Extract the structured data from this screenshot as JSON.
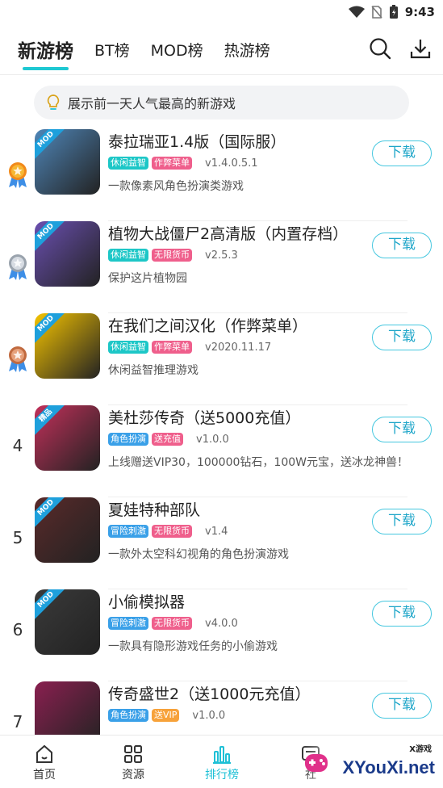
{
  "status": {
    "time": "9:43"
  },
  "tabs": [
    {
      "label": "新游榜",
      "active": true
    },
    {
      "label": "BT榜",
      "active": false
    },
    {
      "label": "MOD榜",
      "active": false
    },
    {
      "label": "热游榜",
      "active": false
    }
  ],
  "tip": {
    "text": "展示前一天人气最高的新游戏",
    "icon": "lightbulb-icon"
  },
  "download_label": "下载",
  "games": [
    {
      "rank": "1",
      "medal": "gold",
      "title": "泰拉瑞亚1.4版（国际服）",
      "badge": "MOD",
      "tags": [
        {
          "text": "休闲益智",
          "color": "#1dc7c7"
        },
        {
          "text": "作弊菜单",
          "color": "#ef5f8c"
        }
      ],
      "version": "v1.4.0.5.1",
      "desc": "一款像素风角色扮演类游戏",
      "thumb_color": "#4f86b8"
    },
    {
      "rank": "2",
      "medal": "silver",
      "title": "植物大战僵尸2高清版（内置存档）",
      "badge": "MOD",
      "tags": [
        {
          "text": "休闲益智",
          "color": "#1dc7c7"
        },
        {
          "text": "无限货币",
          "color": "#ef5f8c"
        }
      ],
      "version": "v2.5.3",
      "desc": "保护这片植物园",
      "thumb_color": "#6a4fb0"
    },
    {
      "rank": "3",
      "medal": "bronze",
      "title": "在我们之间汉化（作弊菜单）",
      "badge": "MOD",
      "tags": [
        {
          "text": "休闲益智",
          "color": "#1dc7c7"
        },
        {
          "text": "作弊菜单",
          "color": "#ef5f8c"
        }
      ],
      "version": "v2020.11.17",
      "desc": "休闲益智推理游戏",
      "thumb_color": "#f5c400"
    },
    {
      "rank": "4",
      "medal": "",
      "title": "美杜莎传奇（送5000充值）",
      "badge": "精品",
      "tags": [
        {
          "text": "角色扮演",
          "color": "#3aa0e8"
        },
        {
          "text": "送充值",
          "color": "#ef5f8c"
        }
      ],
      "version": "v1.0.0",
      "desc": "上线赠送VIP30，100000钻石，100W元宝，送冰龙神兽！",
      "thumb_color": "#c2305a"
    },
    {
      "rank": "5",
      "medal": "",
      "title": "夏娃特种部队",
      "badge": "MOD",
      "tags": [
        {
          "text": "冒险刺激",
          "color": "#3aa0e8"
        },
        {
          "text": "无限货币",
          "color": "#ef5f8c"
        }
      ],
      "version": "v1.4",
      "desc": "一款外太空科幻视角的角色扮演游戏",
      "thumb_color": "#5a2a2a"
    },
    {
      "rank": "6",
      "medal": "",
      "title": "小偷模拟器",
      "badge": "MOD",
      "tags": [
        {
          "text": "冒险刺激",
          "color": "#3aa0e8"
        },
        {
          "text": "无限货币",
          "color": "#ef5f8c"
        }
      ],
      "version": "v4.0.0",
      "desc": "一款具有隐形游戏任务的小偷游戏",
      "thumb_color": "#3a3a3a"
    },
    {
      "rank": "7",
      "medal": "",
      "title": "传奇盛世2（送1000元充值）",
      "badge": "",
      "tags": [
        {
          "text": "角色扮演",
          "color": "#3aa0e8"
        },
        {
          "text": "送VIP",
          "color": "#f7a23a"
        }
      ],
      "version": "v1.0.0",
      "desc": "",
      "thumb_color": "#8a2050"
    }
  ],
  "bottom_nav": [
    {
      "label": "首页",
      "icon": "home-icon",
      "active": false
    },
    {
      "label": "资源",
      "icon": "grid-icon",
      "active": false
    },
    {
      "label": "排行榜",
      "icon": "bar-chart-icon",
      "active": true
    },
    {
      "label": "社",
      "icon": "community-icon",
      "active": false
    }
  ],
  "watermark": {
    "text": "XYouXi.net",
    "small": "X游戏"
  }
}
